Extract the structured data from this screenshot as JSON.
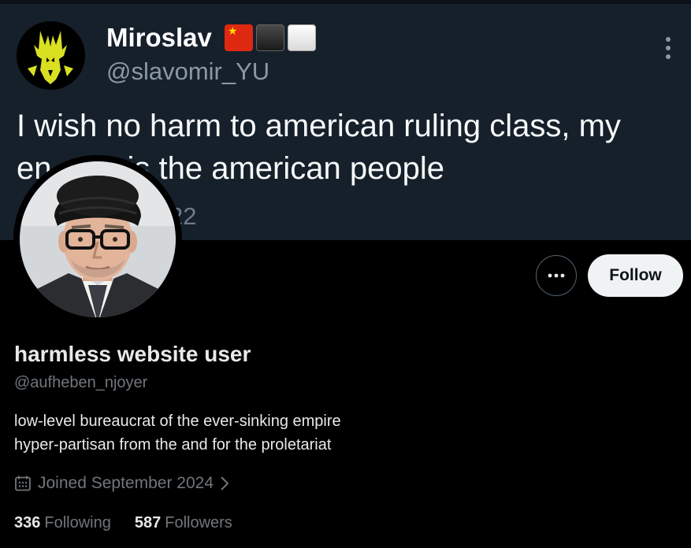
{
  "banner": {
    "tweet": {
      "author_name": "Miroslav",
      "author_flags": [
        "china-flag",
        "black-square",
        "white-square"
      ],
      "author_handle": "@slavomir_YU",
      "text_line1": "I wish no harm to american ruling class, my",
      "text_line2_prefix": "en",
      "text_line2_mid": "is",
      "text_line2_suffix": "the american people",
      "date_fragment": "22"
    }
  },
  "profile": {
    "display_name": "harmless website user",
    "username": "@aufheben_njoyer",
    "bio_lines": [
      "low-level bureaucrat of the ever-sinking empire",
      "hyper-partisan from the and for the proletariat"
    ],
    "joined": "Joined September 2024",
    "following_count": "336",
    "following_label": "Following",
    "followers_count": "587",
    "followers_label": "Followers"
  },
  "actions": {
    "more_label": "•••",
    "follow_label": "Follow"
  },
  "colors": {
    "background": "#000000",
    "banner_background": "#15202b",
    "primary_text": "#e7e9ea",
    "secondary_text": "#71767b",
    "follow_button_bg": "#eff3f4"
  }
}
